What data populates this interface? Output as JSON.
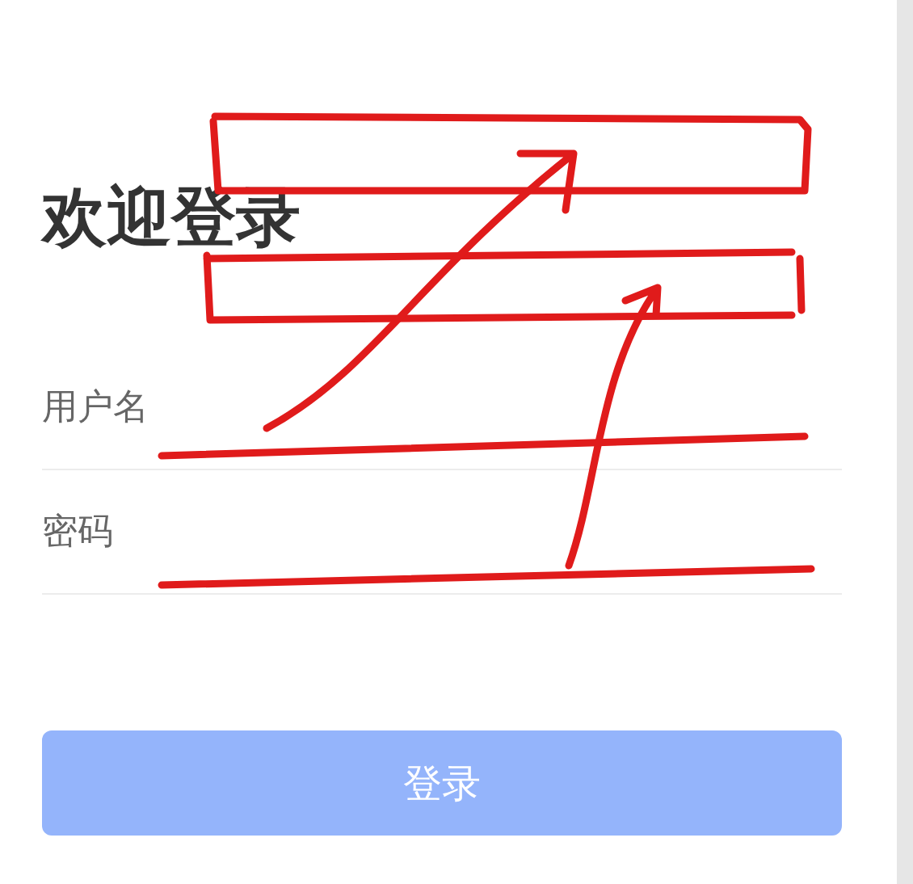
{
  "title": "欢迎登录",
  "fields": [
    {
      "placeholder": "用户名"
    },
    {
      "placeholder": "密码"
    }
  ],
  "login_button": "登录"
}
